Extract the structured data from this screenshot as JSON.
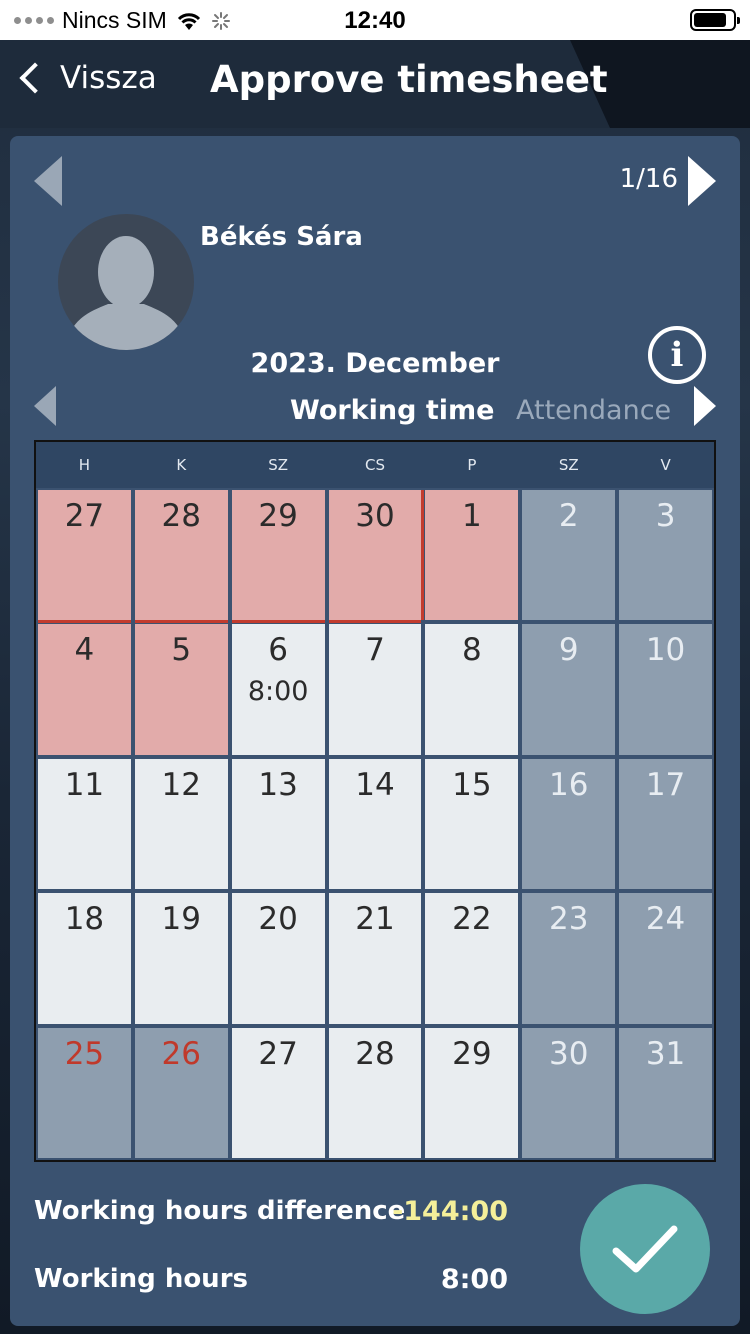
{
  "status_bar": {
    "carrier": "Nincs SIM",
    "time": "12:40"
  },
  "nav": {
    "back_label": "Vissza",
    "title": "Approve timesheet"
  },
  "pager": "1/16",
  "person": {
    "name": "Békés Sára"
  },
  "calendar": {
    "month": "2023. December",
    "tabs": {
      "working_time": "Working time",
      "attendance": "Attendance"
    },
    "weekdays": [
      "H",
      "K",
      "SZ",
      "CS",
      "P",
      "SZ",
      "V"
    ],
    "days": [
      {
        "label": "27",
        "type": "red",
        "line": "b"
      },
      {
        "label": "28",
        "type": "red",
        "line": "b"
      },
      {
        "label": "29",
        "type": "red",
        "line": "b"
      },
      {
        "label": "30",
        "type": "red",
        "line": "br"
      },
      {
        "label": "1",
        "type": "red"
      },
      {
        "label": "2",
        "type": "weekend"
      },
      {
        "label": "3",
        "type": "weekend"
      },
      {
        "label": "4",
        "type": "red"
      },
      {
        "label": "5",
        "type": "red"
      },
      {
        "label": "6",
        "type": "work",
        "sub": "8:00"
      },
      {
        "label": "7",
        "type": "work"
      },
      {
        "label": "8",
        "type": "work"
      },
      {
        "label": "9",
        "type": "weekend"
      },
      {
        "label": "10",
        "type": "weekend"
      },
      {
        "label": "11",
        "type": "work"
      },
      {
        "label": "12",
        "type": "work"
      },
      {
        "label": "13",
        "type": "work"
      },
      {
        "label": "14",
        "type": "work"
      },
      {
        "label": "15",
        "type": "work"
      },
      {
        "label": "16",
        "type": "weekend"
      },
      {
        "label": "17",
        "type": "weekend"
      },
      {
        "label": "18",
        "type": "work"
      },
      {
        "label": "19",
        "type": "work"
      },
      {
        "label": "20",
        "type": "work"
      },
      {
        "label": "21",
        "type": "work"
      },
      {
        "label": "22",
        "type": "work"
      },
      {
        "label": "23",
        "type": "weekend"
      },
      {
        "label": "24",
        "type": "weekend"
      },
      {
        "label": "25",
        "type": "holiday"
      },
      {
        "label": "26",
        "type": "holiday"
      },
      {
        "label": "27",
        "type": "work"
      },
      {
        "label": "28",
        "type": "work"
      },
      {
        "label": "29",
        "type": "work"
      },
      {
        "label": "30",
        "type": "weekend"
      },
      {
        "label": "31",
        "type": "weekend"
      }
    ]
  },
  "summary": {
    "diff_label": "Working hours difference",
    "diff_value": "-144:00",
    "hours_label": "Working hours",
    "hours_value": "8:00"
  },
  "colors": {
    "diff_value": "#f4ef9a",
    "approve": "#5aa9a8",
    "holiday_text": "#c0392b"
  }
}
